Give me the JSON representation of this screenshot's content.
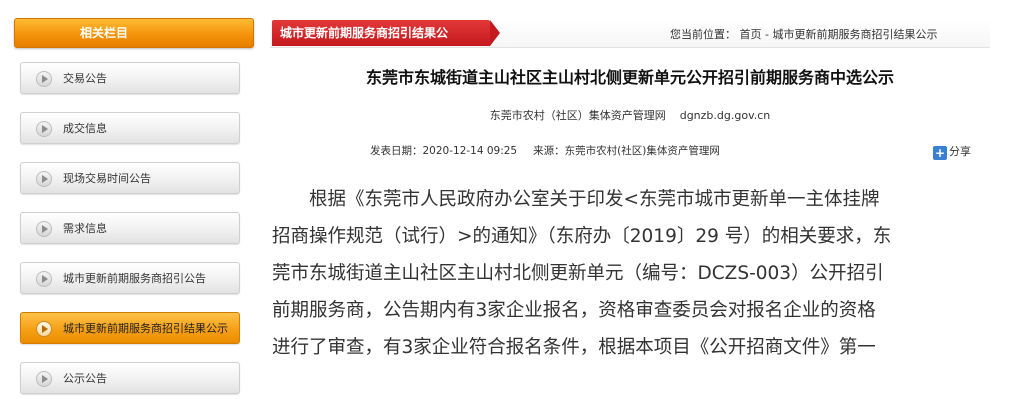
{
  "sidebar": {
    "header": "相关栏目",
    "items": [
      {
        "label": "交易公告"
      },
      {
        "label": "成交信息"
      },
      {
        "label": "现场交易时间公告"
      },
      {
        "label": "需求信息"
      },
      {
        "label": "城市更新前期服务商招引公告"
      },
      {
        "label": "城市更新前期服务商招引结果公示"
      },
      {
        "label": "公示公告"
      }
    ]
  },
  "topbar": {
    "category": "城市更新前期服务商招引结果公",
    "location_label": "您当前位置：",
    "home": "首页",
    "separator": " - ",
    "current": "城市更新前期服务商招引结果公示"
  },
  "article": {
    "title": "东莞市东城街道主山社区主山村北侧更新单元公开招引前期服务商中选公示",
    "source_name": "东莞市农村（社区）集体资产管理网",
    "source_url": "dgnzb.dg.gov.cn",
    "published": "发表日期：2020-12-14 09:25",
    "origin": "来源：东莞市农村(社区)集体资产管理网",
    "share": "分享",
    "lines": [
      "　　根据《东莞市人民政府办公室关于印发<东莞市城市更新单一主体挂牌",
      "招商操作规范（试行）>的通知》（东府办〔2019〕29 号）的相关要求，东",
      "莞市东城街道主山社区主山村北侧更新单元（编号：DCZS-003）公开招引",
      "前期服务商，公告期内有3家企业报名，资格审查委员会对报名企业的资格",
      "进行了审查，有3家企业符合报名条件，根据本项目《公开招商文件》第一"
    ]
  },
  "colors": {
    "sidebar_header": "#f39008",
    "active_item": "#f5a016",
    "category_tab": "#c41a1d",
    "share_icon": "#3a7fd0"
  },
  "icons": {
    "sidebar_item": "play-circle-icon",
    "share": "plus-icon"
  }
}
